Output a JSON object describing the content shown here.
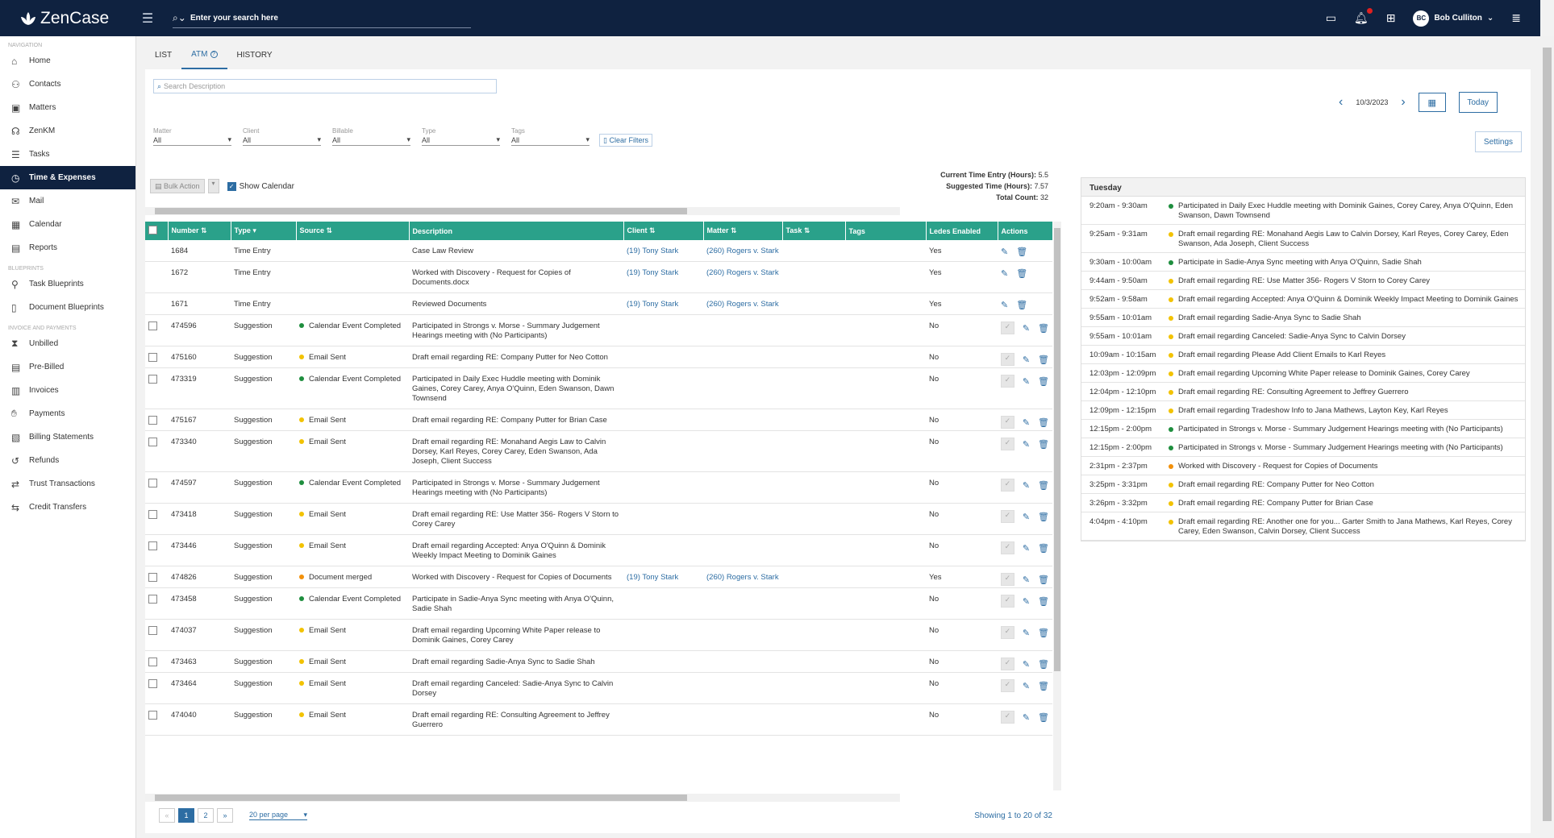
{
  "app": {
    "name": "ZenCase"
  },
  "topbar": {
    "search_placeholder": "Enter your search here",
    "user_initials": "BC",
    "user_name": "Bob Culliton"
  },
  "sidebar": {
    "sections": [
      "NAVIGATION",
      "BLUEPRINTS",
      "INVOICE AND PAYMENTS"
    ],
    "nav": [
      {
        "label": "Home",
        "icon": "home-icon"
      },
      {
        "label": "Contacts",
        "icon": "contacts-icon"
      },
      {
        "label": "Matters",
        "icon": "briefcase-icon"
      },
      {
        "label": "ZenKM",
        "icon": "brain-icon"
      },
      {
        "label": "Tasks",
        "icon": "tasks-icon"
      },
      {
        "label": "Time & Expenses",
        "icon": "clock-icon"
      },
      {
        "label": "Mail",
        "icon": "mail-icon"
      },
      {
        "label": "Calendar",
        "icon": "calendar-icon"
      },
      {
        "label": "Reports",
        "icon": "reports-icon"
      }
    ],
    "blueprints": [
      {
        "label": "Task Blueprints",
        "icon": "task-blueprint-icon"
      },
      {
        "label": "Document Blueprints",
        "icon": "document-blueprint-icon"
      }
    ],
    "invoice": [
      {
        "label": "Unbilled",
        "icon": "hourglass-icon"
      },
      {
        "label": "Pre-Billed",
        "icon": "prebilled-icon"
      },
      {
        "label": "Invoices",
        "icon": "invoice-icon"
      },
      {
        "label": "Payments",
        "icon": "payments-icon"
      },
      {
        "label": "Billing Statements",
        "icon": "statement-icon"
      },
      {
        "label": "Refunds",
        "icon": "refund-icon"
      },
      {
        "label": "Trust Transactions",
        "icon": "trust-icon"
      },
      {
        "label": "Credit Transfers",
        "icon": "transfer-icon"
      }
    ]
  },
  "tabs": [
    "LIST",
    "ATM",
    "HISTORY"
  ],
  "search": {
    "placeholder": "Search Description"
  },
  "filters": [
    {
      "label": "Matter",
      "value": "All"
    },
    {
      "label": "Client",
      "value": "All"
    },
    {
      "label": "Billable",
      "value": "All"
    },
    {
      "label": "Type",
      "value": "All"
    },
    {
      "label": "Tags",
      "value": "All"
    }
  ],
  "clear_filters": "Clear Filters",
  "bulk_action": "Bulk Action",
  "show_calendar": "Show Calendar",
  "stats": {
    "current_label": "Current Time Entry (Hours):",
    "current_value": "5.5",
    "suggested_label": "Suggested Time (Hours):",
    "suggested_value": "7.57",
    "total_label": "Total Count:",
    "total_value": "32"
  },
  "table": {
    "columns": [
      "Number",
      "Type",
      "Source",
      "Description",
      "Client",
      "Matter",
      "Task",
      "Tags",
      "Ledes Enabled",
      "Actions"
    ],
    "rows": [
      {
        "number": "1684",
        "type": "Time Entry",
        "source": "",
        "color": "",
        "description": "Case Law Review",
        "client": "(19) Tony Stark",
        "matter": "(260) Rogers v. Stark",
        "ledes": "Yes",
        "checkbox": false
      },
      {
        "number": "1672",
        "type": "Time Entry",
        "source": "",
        "color": "",
        "description": "Worked with Discovery - Request for Copies of Documents.docx",
        "client": "(19) Tony Stark",
        "matter": "(260) Rogers v. Stark",
        "ledes": "Yes",
        "checkbox": false
      },
      {
        "number": "1671",
        "type": "Time Entry",
        "source": "",
        "color": "",
        "description": "Reviewed Documents",
        "client": "(19) Tony Stark",
        "matter": "(260) Rogers v. Stark",
        "ledes": "Yes",
        "checkbox": false
      },
      {
        "number": "474596",
        "type": "Suggestion",
        "source": "Calendar Event Completed",
        "color": "#1e8e3e",
        "description": "Participated in Strongs v. Morse - Summary Judgement Hearings meeting with (No Participants)",
        "client": "",
        "matter": "",
        "ledes": "No",
        "checkbox": true
      },
      {
        "number": "475160",
        "type": "Suggestion",
        "source": "Email Sent",
        "color": "#f2c200",
        "description": "Draft email regarding RE: Company Putter for Neo Cotton",
        "client": "",
        "matter": "",
        "ledes": "No",
        "checkbox": true
      },
      {
        "number": "473319",
        "type": "Suggestion",
        "source": "Calendar Event Completed",
        "color": "#1e8e3e",
        "description": "Participated in Daily Exec Huddle meeting with Dominik Gaines, Corey Carey, Anya O'Quinn, Eden Swanson, Dawn Townsend",
        "client": "",
        "matter": "",
        "ledes": "No",
        "checkbox": true
      },
      {
        "number": "475167",
        "type": "Suggestion",
        "source": "Email Sent",
        "color": "#f2c200",
        "description": "Draft email regarding RE: Company Putter for Brian Case",
        "client": "",
        "matter": "",
        "ledes": "No",
        "checkbox": true
      },
      {
        "number": "473340",
        "type": "Suggestion",
        "source": "Email Sent",
        "color": "#f2c200",
        "description": "Draft email regarding RE: Monahand Aegis Law to Calvin Dorsey, Karl Reyes, Corey Carey, Eden Swanson, Ada Joseph, Client Success",
        "client": "",
        "matter": "",
        "ledes": "No",
        "checkbox": true
      },
      {
        "number": "474597",
        "type": "Suggestion",
        "source": "Calendar Event Completed",
        "color": "#1e8e3e",
        "description": "Participated in Strongs v. Morse - Summary Judgement Hearings meeting with (No Participants)",
        "client": "",
        "matter": "",
        "ledes": "No",
        "checkbox": true
      },
      {
        "number": "473418",
        "type": "Suggestion",
        "source": "Email Sent",
        "color": "#f2c200",
        "description": "Draft email regarding RE: Use Matter 356- Rogers V Storn to Corey Carey",
        "client": "",
        "matter": "",
        "ledes": "No",
        "checkbox": true
      },
      {
        "number": "473446",
        "type": "Suggestion",
        "source": "Email Sent",
        "color": "#f2c200",
        "description": "Draft email regarding Accepted: Anya O'Quinn & Dominik Weekly Impact Meeting to Dominik Gaines",
        "client": "",
        "matter": "",
        "ledes": "No",
        "checkbox": true
      },
      {
        "number": "474826",
        "type": "Suggestion",
        "source": "Document merged",
        "color": "#f2900a",
        "description": "Worked with Discovery - Request for Copies of Documents",
        "client": "(19) Tony Stark",
        "matter": "(260) Rogers v. Stark",
        "ledes": "Yes",
        "checkbox": true
      },
      {
        "number": "473458",
        "type": "Suggestion",
        "source": "Calendar Event Completed",
        "color": "#1e8e3e",
        "description": "Participate in Sadie-Anya Sync meeting with Anya O'Quinn, Sadie Shah",
        "client": "",
        "matter": "",
        "ledes": "No",
        "checkbox": true
      },
      {
        "number": "474037",
        "type": "Suggestion",
        "source": "Email Sent",
        "color": "#f2c200",
        "description": "Draft email regarding Upcoming White Paper release to Dominik Gaines, Corey Carey",
        "client": "",
        "matter": "",
        "ledes": "No",
        "checkbox": true
      },
      {
        "number": "473463",
        "type": "Suggestion",
        "source": "Email Sent",
        "color": "#f2c200",
        "description": "Draft email regarding Sadie-Anya Sync to Sadie Shah",
        "client": "",
        "matter": "",
        "ledes": "No",
        "checkbox": true
      },
      {
        "number": "473464",
        "type": "Suggestion",
        "source": "Email Sent",
        "color": "#f2c200",
        "description": "Draft email regarding Canceled: Sadie-Anya Sync to Calvin Dorsey",
        "client": "",
        "matter": "",
        "ledes": "No",
        "checkbox": true
      },
      {
        "number": "474040",
        "type": "Suggestion",
        "source": "Email Sent",
        "color": "#f2c200",
        "description": "Draft email regarding RE: Consulting Agreement to Jeffrey Guerrero",
        "client": "",
        "matter": "",
        "ledes": "No",
        "checkbox": true
      }
    ]
  },
  "pagination": {
    "prev": "«",
    "pages": [
      "1",
      "2"
    ],
    "next": "»",
    "per_page": "20 per page",
    "showing": "Showing 1 to 20 of 32"
  },
  "calendar": {
    "date": "10/3/2023",
    "today": "Today",
    "settings": "Settings",
    "day": "Tuesday",
    "events": [
      {
        "time": "9:20am - 9:30am",
        "color": "#1e8e3e",
        "text": "Participated in Daily Exec Huddle meeting with Dominik Gaines, Corey Carey, Anya O'Quinn, Eden Swanson, Dawn Townsend"
      },
      {
        "time": "9:25am - 9:31am",
        "color": "#f2c200",
        "text": "Draft email regarding RE: Monahand Aegis Law to Calvin Dorsey, Karl Reyes, Corey Carey, Eden Swanson, Ada Joseph, Client Success"
      },
      {
        "time": "9:30am - 10:00am",
        "color": "#1e8e3e",
        "text": "Participate in Sadie-Anya Sync meeting with Anya O'Quinn, Sadie Shah"
      },
      {
        "time": "9:44am - 9:50am",
        "color": "#f2c200",
        "text": "Draft email regarding RE: Use Matter 356- Rogers V Storn to Corey Carey"
      },
      {
        "time": "9:52am - 9:58am",
        "color": "#f2c200",
        "text": "Draft email regarding Accepted: Anya O'Quinn & Dominik Weekly Impact Meeting to Dominik Gaines"
      },
      {
        "time": "9:55am - 10:01am",
        "color": "#f2c200",
        "text": "Draft email regarding Sadie-Anya Sync to Sadie Shah"
      },
      {
        "time": "9:55am - 10:01am",
        "color": "#f2c200",
        "text": "Draft email regarding Canceled: Sadie-Anya Sync to Calvin Dorsey"
      },
      {
        "time": "10:09am - 10:15am",
        "color": "#f2c200",
        "text": "Draft email regarding Please Add Client Emails to Karl Reyes"
      },
      {
        "time": "12:03pm - 12:09pm",
        "color": "#f2c200",
        "text": "Draft email regarding Upcoming White Paper release to Dominik Gaines, Corey Carey"
      },
      {
        "time": "12:04pm - 12:10pm",
        "color": "#f2c200",
        "text": "Draft email regarding RE: Consulting Agreement to Jeffrey Guerrero"
      },
      {
        "time": "12:09pm - 12:15pm",
        "color": "#f2c200",
        "text": "Draft email regarding Tradeshow Info to Jana Mathews, Layton Key, Karl Reyes"
      },
      {
        "time": "12:15pm - 2:00pm",
        "color": "#1e8e3e",
        "text": "Participated in Strongs v. Morse - Summary Judgement Hearings meeting with (No Participants)"
      },
      {
        "time": "12:15pm - 2:00pm",
        "color": "#1e8e3e",
        "text": "Participated in Strongs v. Morse - Summary Judgement Hearings meeting with (No Participants)"
      },
      {
        "time": "2:31pm - 2:37pm",
        "color": "#f2900a",
        "text": "Worked with Discovery - Request for Copies of Documents"
      },
      {
        "time": "3:25pm - 3:31pm",
        "color": "#f2c200",
        "text": "Draft email regarding RE: Company Putter for Neo Cotton"
      },
      {
        "time": "3:26pm - 3:32pm",
        "color": "#f2c200",
        "text": "Draft email regarding RE: Company Putter for Brian Case"
      },
      {
        "time": "4:04pm - 4:10pm",
        "color": "#f2c200",
        "text": "Draft email regarding RE: Another one for you... Garter Smith to Jana Mathews, Karl Reyes, Corey Carey, Eden Swanson, Calvin Dorsey, Client Success"
      }
    ]
  },
  "colors": {
    "navy": "#0f2240",
    "teal": "#2aa18a",
    "link": "#2d6da3"
  }
}
